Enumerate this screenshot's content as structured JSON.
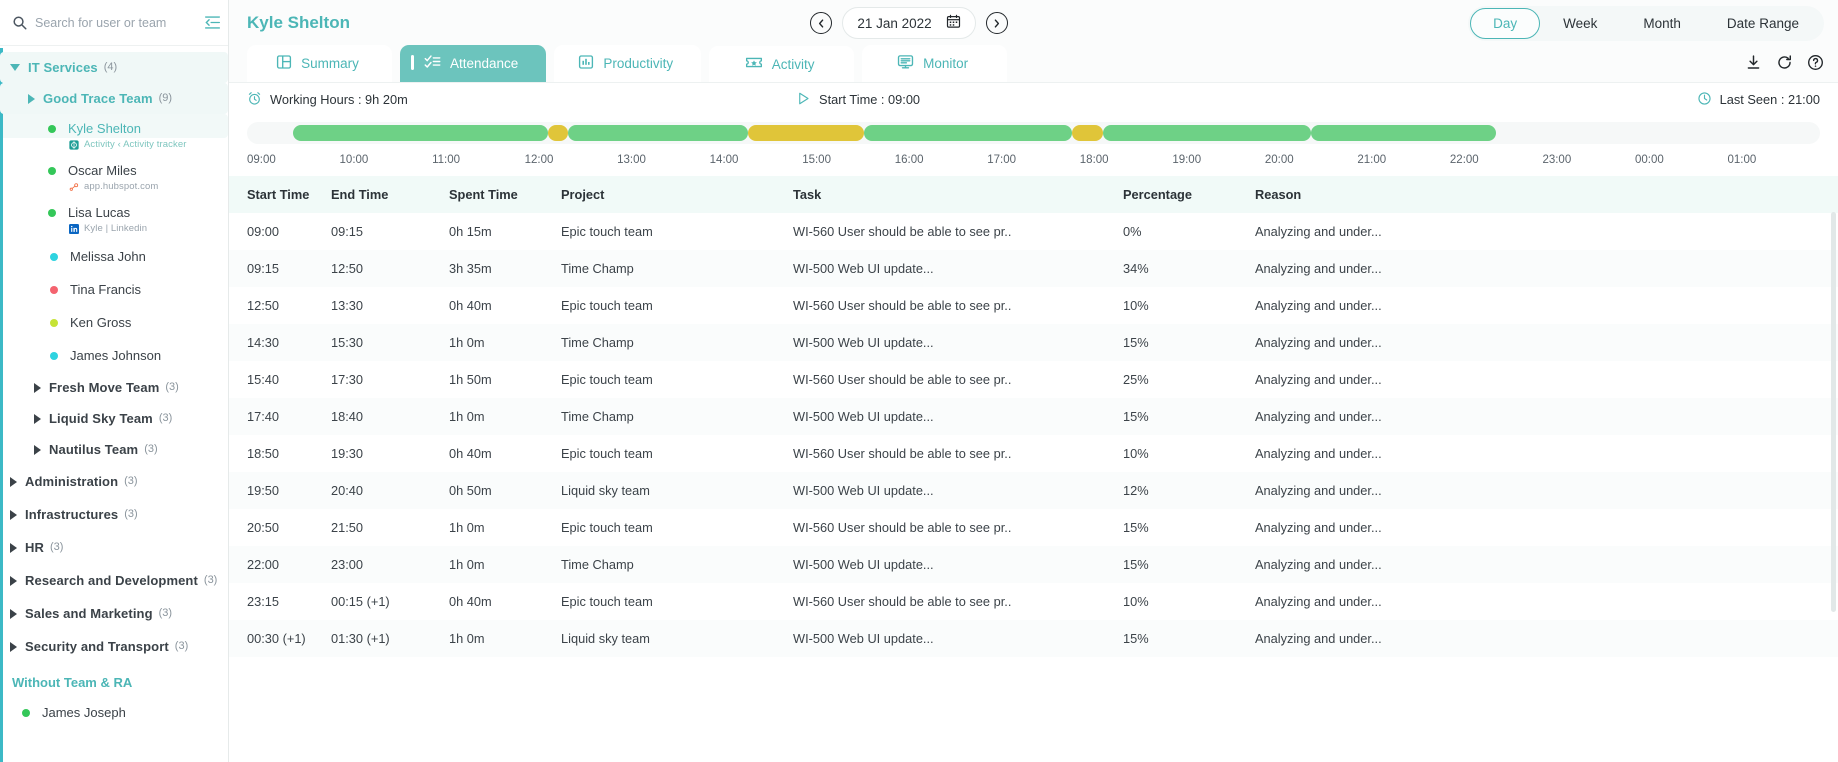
{
  "sidebar": {
    "search": {
      "placeholder": "Search for user or team",
      "value": ""
    },
    "groups": [
      {
        "label": "IT Services",
        "count": "(4)"
      },
      {
        "label": "Good Trace Team",
        "count": "(9)"
      },
      {
        "label": "Fresh Move Team",
        "count": "(3)"
      },
      {
        "label": "Liquid Sky Team",
        "count": "(3)"
      },
      {
        "label": "Nautilus Team",
        "count": "(3)"
      },
      {
        "label": "Administration",
        "count": "(3)"
      },
      {
        "label": "Infrastructures",
        "count": "(3)"
      },
      {
        "label": "HR",
        "count": "(3)"
      },
      {
        "label": "Research and Development",
        "count": "(3)"
      },
      {
        "label": "Sales and Marketing",
        "count": "(3)"
      },
      {
        "label": "Security and Transport",
        "count": "(3)"
      }
    ],
    "users": [
      {
        "name": "Kyle Shelton",
        "sub": "Activity ‹ Activity tracker",
        "dot": "#34c759",
        "sub_icon": "target-icon"
      },
      {
        "name": "Oscar Miles",
        "sub": "app.hubspot.com",
        "dot": "#34c759",
        "sub_icon": "hubspot-icon"
      },
      {
        "name": "Lisa Lucas",
        "sub": "Kyle | Linkedin",
        "dot": "#34c759",
        "sub_icon": "linkedin-icon"
      },
      {
        "name": "Melissa John",
        "sub": "",
        "dot": "#2ed3e0",
        "sub_icon": ""
      },
      {
        "name": "Tina Francis",
        "sub": "",
        "dot": "#f4636f",
        "sub_icon": ""
      },
      {
        "name": "Ken Gross",
        "sub": "",
        "dot": "#c6e336",
        "sub_icon": ""
      },
      {
        "name": "James Johnson",
        "sub": "",
        "dot": "#2ed3e0",
        "sub_icon": ""
      }
    ],
    "without_team_label": "Without Team & RA",
    "without_team_users": [
      {
        "name": "James Joseph",
        "dot": "#34c759"
      }
    ]
  },
  "header": {
    "title": "Kyle Shelton",
    "date": "21 Jan 2022",
    "prev_icon": "chevron-left-circle-icon",
    "next_icon": "chevron-right-circle-icon",
    "calendar_icon": "calendar-icon",
    "ranges": [
      "Day",
      "Week",
      "Month",
      "Date Range"
    ],
    "active_range": "Day"
  },
  "tabs": {
    "items": [
      {
        "label": "Summary",
        "icon": "layout-icon"
      },
      {
        "label": "Attendance",
        "icon": "checklist-icon"
      },
      {
        "label": "Productivity",
        "icon": "bar-chart-icon"
      },
      {
        "label": "Activity",
        "icon": "ticket-icon"
      },
      {
        "label": "Monitor",
        "icon": "monitor-icon"
      }
    ],
    "active": "Attendance",
    "actions": [
      {
        "name": "download-icon"
      },
      {
        "name": "refresh-icon"
      },
      {
        "name": "help-icon"
      }
    ]
  },
  "stats": {
    "working_hours_label": "Working Hours : 9h 20m",
    "working_hours_icon": "alarm-clock-icon",
    "start_time_label": "Start Time : 09:00",
    "start_time_icon": "play-icon",
    "last_seen_label": "Last Seen : 21:00",
    "last_seen_icon": "clock-icon"
  },
  "chart_data": {
    "type": "bar",
    "title": "Attendance timeline",
    "xlabel": "",
    "ylabel": "",
    "x_ticks": [
      "09:00",
      "10:00",
      "11:00",
      "12:00",
      "13:00",
      "14:00",
      "15:00",
      "16:00",
      "17:00",
      "18:00",
      "19:00",
      "20:00",
      "21:00",
      "22:00",
      "23:00",
      "00:00",
      "01:00"
    ],
    "axis_range": [
      "08:30",
      "01:30"
    ],
    "colors": {
      "active": "#6ed186",
      "idle": "#e0c539",
      "empty": "#f6f8f8"
    },
    "segments": [
      {
        "start": "09:00",
        "end": "11:45",
        "state": "active",
        "color": "#6ed186"
      },
      {
        "start": "11:45",
        "end": "11:58",
        "state": "idle",
        "color": "#e0c539"
      },
      {
        "start": "11:58",
        "end": "13:55",
        "state": "active",
        "color": "#6ed186"
      },
      {
        "start": "13:55",
        "end": "15:10",
        "state": "idle",
        "color": "#e0c539"
      },
      {
        "start": "15:10",
        "end": "17:25",
        "state": "active",
        "color": "#6ed186"
      },
      {
        "start": "17:25",
        "end": "17:45",
        "state": "idle",
        "color": "#e0c539"
      },
      {
        "start": "17:45",
        "end": "20:00",
        "state": "active",
        "color": "#6ed186"
      },
      {
        "start": "20:00",
        "end": "22:00",
        "state": "active",
        "color": "#6ed186"
      }
    ]
  },
  "table": {
    "columns": [
      "Start Time",
      "End Time",
      "Spent Time",
      "Project",
      "Task",
      "Percentage",
      "Reason"
    ],
    "rows": [
      {
        "start": "09:00",
        "end": "09:15",
        "spent": "0h 15m",
        "project": "Epic touch team",
        "task": "WI-560 User should be able to see pr..",
        "pct": "0%",
        "reason": "Analyzing and under..."
      },
      {
        "start": "09:15",
        "end": "12:50",
        "spent": "3h 35m",
        "project": "Time Champ",
        "task": "WI-500 Web UI update...",
        "pct": "34%",
        "reason": "Analyzing and under..."
      },
      {
        "start": "12:50",
        "end": "13:30",
        "spent": "0h 40m",
        "project": "Epic touch team",
        "task": "WI-560 User should be able to see pr..",
        "pct": "10%",
        "reason": "Analyzing and under..."
      },
      {
        "start": "14:30",
        "end": "15:30",
        "spent": "1h 0m",
        "project": "Time Champ",
        "task": "WI-500 Web UI update...",
        "pct": "15%",
        "reason": "Analyzing and under..."
      },
      {
        "start": "15:40",
        "end": "17:30",
        "spent": "1h 50m",
        "project": "Epic touch team",
        "task": "WI-560 User should be able to see pr..",
        "pct": "25%",
        "reason": "Analyzing and under..."
      },
      {
        "start": "17:40",
        "end": "18:40",
        "spent": "1h 0m",
        "project": "Time Champ",
        "task": "WI-500 Web UI update...",
        "pct": "15%",
        "reason": "Analyzing and under..."
      },
      {
        "start": "18:50",
        "end": "19:30",
        "spent": "0h 40m",
        "project": "Epic touch team",
        "task": "WI-560 User should be able to see pr..",
        "pct": "10%",
        "reason": "Analyzing and under..."
      },
      {
        "start": "19:50",
        "end": "20:40",
        "spent": "0h 50m",
        "project": "Liquid sky team",
        "task": "WI-500 Web UI update...",
        "pct": "12%",
        "reason": "Analyzing and under..."
      },
      {
        "start": "20:50",
        "end": "21:50",
        "spent": "1h 0m",
        "project": "Epic touch team",
        "task": "WI-560 User should be able to see pr..",
        "pct": "15%",
        "reason": "Analyzing and under..."
      },
      {
        "start": "22:00",
        "end": "23:00",
        "spent": "1h 0m",
        "project": "Time Champ",
        "task": "WI-500 Web UI update...",
        "pct": "15%",
        "reason": "Analyzing and under..."
      },
      {
        "start": "23:15",
        "end": "00:15 (+1)",
        "spent": "0h 40m",
        "project": "Epic touch team",
        "task": "WI-560 User should be able to see pr..",
        "pct": "10%",
        "reason": "Analyzing and under..."
      },
      {
        "start": "00:30 (+1)",
        "end": "01:30 (+1)",
        "spent": "1h 0m",
        "project": "Liquid sky team",
        "task": "WI-500 Web UI update...",
        "pct": "15%",
        "reason": "Analyzing and under..."
      }
    ]
  }
}
